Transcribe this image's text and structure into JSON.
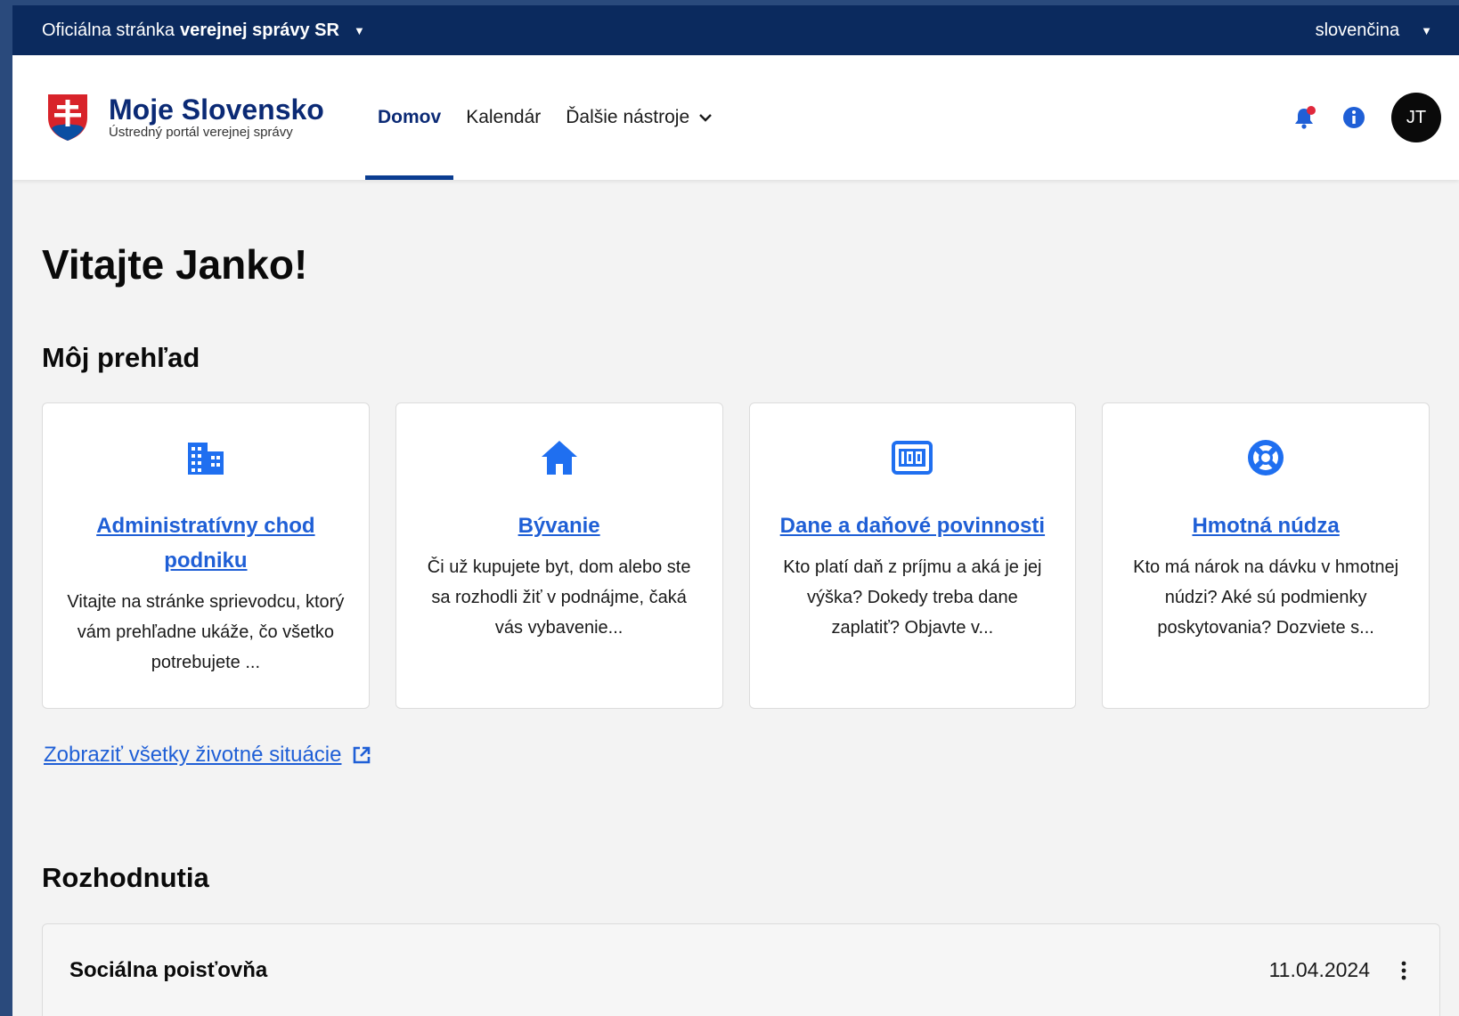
{
  "official_bar": {
    "prefix": "Oficiálna stránka",
    "bold": "verejnej správy SR",
    "language": "slovenčina"
  },
  "brand": {
    "name": "Moje Slovensko",
    "subtitle": "Ústredný portál verejnej správy"
  },
  "nav": {
    "items": [
      {
        "label": "Domov",
        "active": true
      },
      {
        "label": "Kalendár",
        "active": false
      },
      {
        "label": "Ďalšie nástroje",
        "active": false
      }
    ]
  },
  "user": {
    "initials": "JT"
  },
  "icons": [
    "bell-icon",
    "info-icon",
    "chevron-down-icon",
    "external-link-icon",
    "more-vertical-icon"
  ],
  "colors": {
    "primary": "#0b2a5e",
    "link": "#1f5fd6",
    "icon": "#1f6ff0",
    "notification": "#e0283c"
  },
  "main": {
    "welcome": "Vitajte Janko!",
    "overview_title": "Môj prehľad",
    "cards": [
      {
        "icon": "building-icon",
        "title": "Administratívny chod podniku",
        "desc": "Vitajte na stránke sprievodcu, ktorý vám prehľadne ukáže, čo všetko potrebujete ..."
      },
      {
        "icon": "home-icon",
        "title": "Bývanie",
        "desc": "Či už kupujete byt, dom alebo ste sa rozhodli žiť v podnájme, čaká vás vybavenie..."
      },
      {
        "icon": "calculator-icon",
        "title": "Dane a daňové povinnosti",
        "desc": "Kto platí daň z príjmu a aká je jej výška? Dokedy treba dane zaplatiť? Objavte v..."
      },
      {
        "icon": "lifebuoy-icon",
        "title": "Hmotná núdza",
        "desc": "Kto má nárok na dávku v hmotnej núdzi? Aké sú podmienky poskytovania? Dozviete s..."
      }
    ],
    "all_link": "Zobraziť všetky životné situácie",
    "decisions_title": "Rozhodnutia",
    "decisions": [
      {
        "issuer": "Sociálna poisťovňa",
        "date": "11.04.2024"
      }
    ]
  }
}
